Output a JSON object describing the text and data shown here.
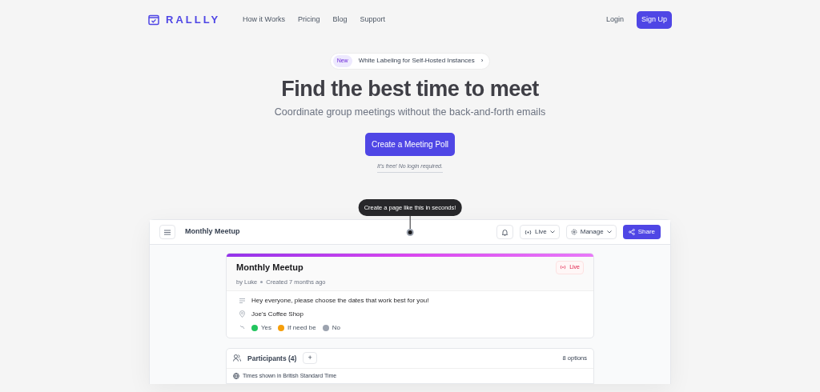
{
  "brand": {
    "name": "RALLLY"
  },
  "nav": {
    "links": [
      "How it Works",
      "Pricing",
      "Blog",
      "Support"
    ],
    "login": "Login",
    "signup": "Sign Up"
  },
  "announcement": {
    "badge": "New",
    "text": "White Labeling for Self-Hosted Instances",
    "chevron": "›"
  },
  "hero": {
    "title": "Find the best time to meet",
    "subtitle": "Coordinate group meetings without the back-and-forth emails",
    "cta": "Create a Meeting Poll",
    "note": "It's free! No login required."
  },
  "tooltip": "Create a page like this in seconds!",
  "demo": {
    "title": "Monthly Meetup",
    "status": "Live",
    "manage": "Manage",
    "share": "Share",
    "poll": {
      "title": "Monthly Meetup",
      "status": "Live",
      "author": "by Luke",
      "created": "Created 7 months ago",
      "description": "Hey everyone, please choose the dates that work best for you!",
      "location": "Joe's Coffee Shop",
      "legend": [
        {
          "label": "Yes",
          "color": "#22c55e"
        },
        {
          "label": "If need be",
          "color": "#f59e0b"
        },
        {
          "label": "No",
          "color": "#9ca3af"
        }
      ]
    },
    "participants": {
      "label": "Participants (4)",
      "add": "+",
      "options": "8 options",
      "timezone": "Times shown in British Standard Time"
    }
  }
}
